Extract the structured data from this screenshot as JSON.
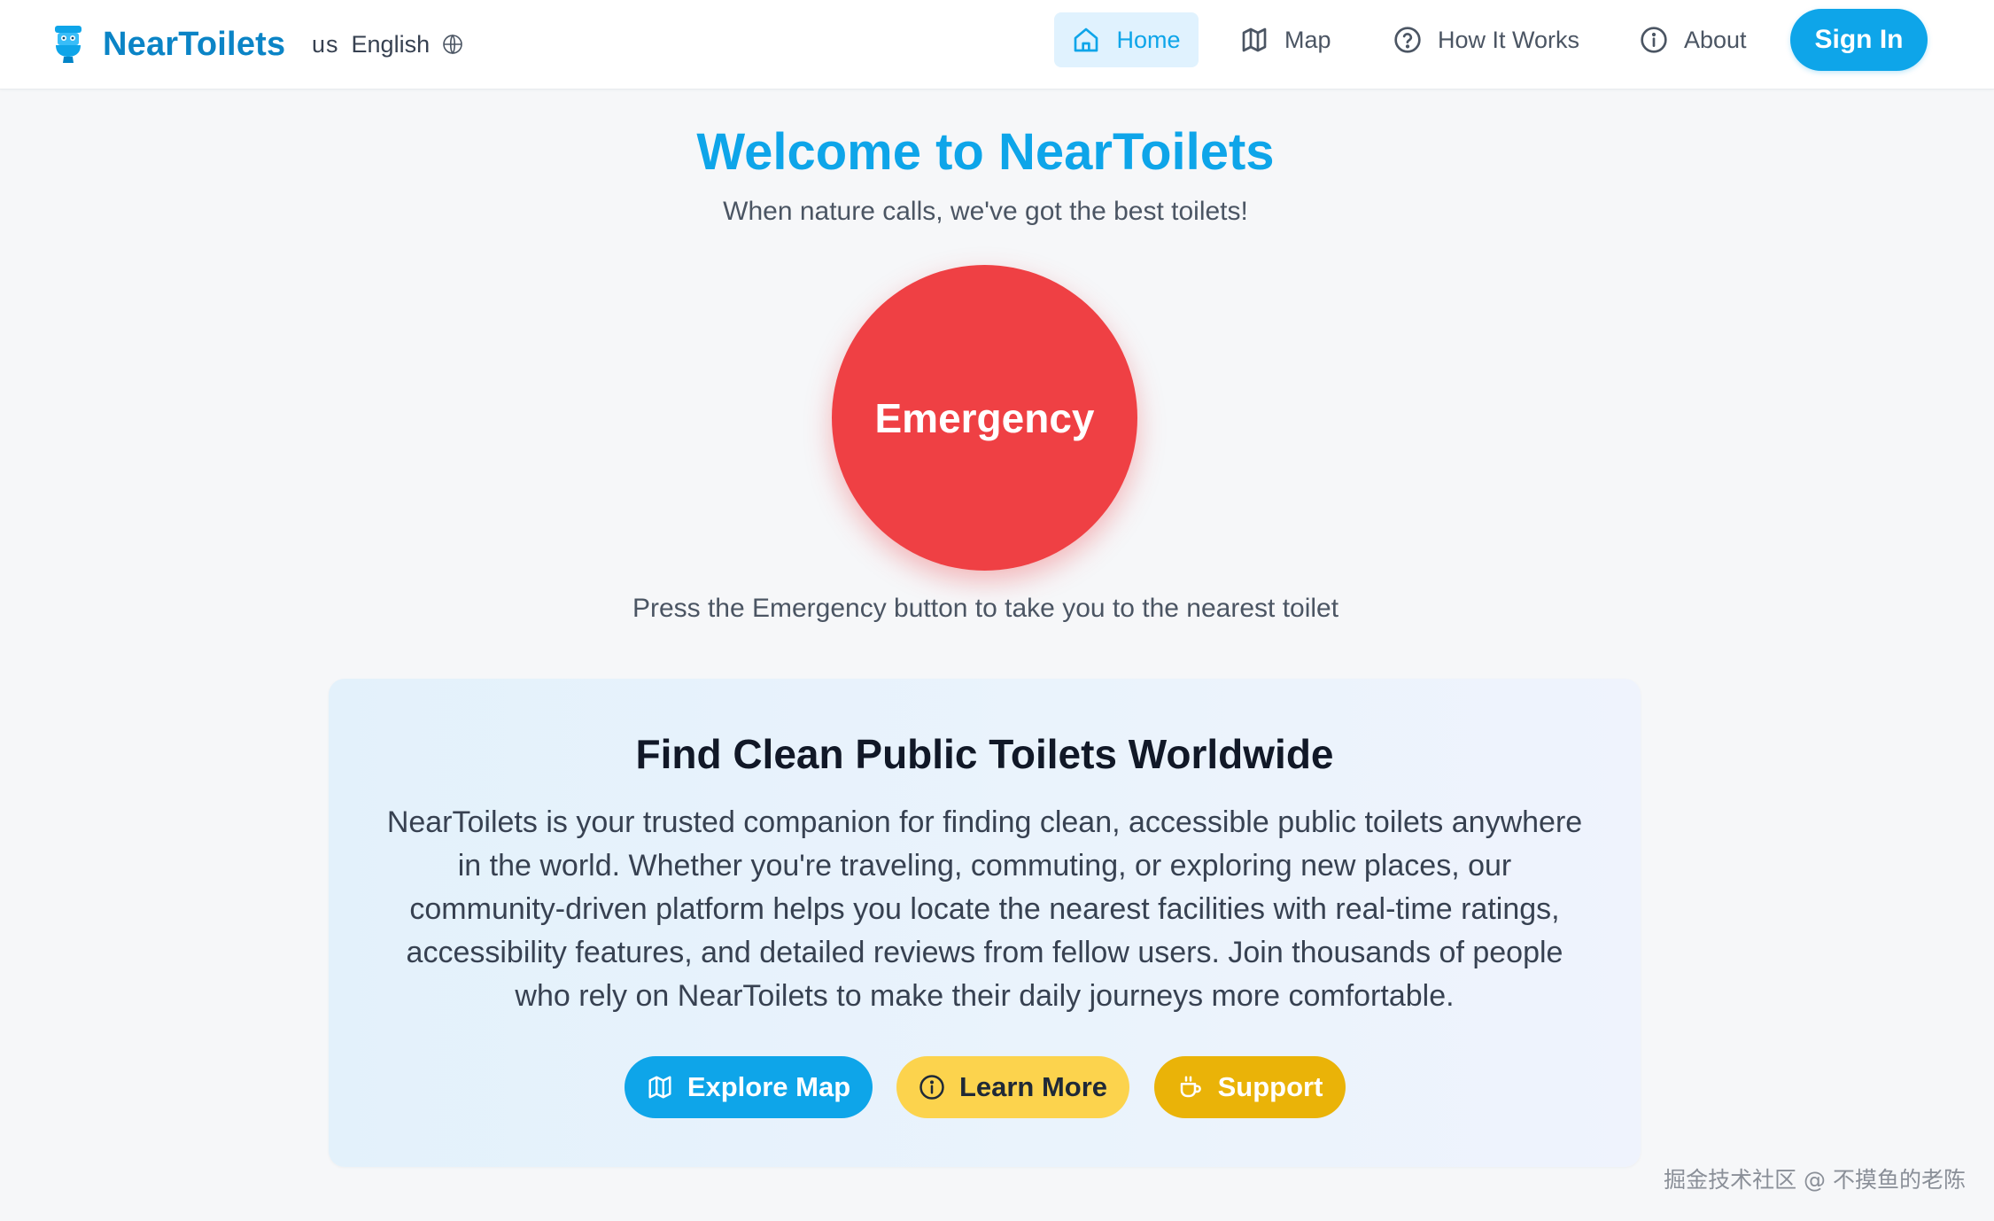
{
  "header": {
    "brand": "NearToilets",
    "language": {
      "flag": "us",
      "label": "English"
    },
    "nav": [
      {
        "label": "Home",
        "icon": "home-icon",
        "active": true
      },
      {
        "label": "Map",
        "icon": "map-icon",
        "active": false
      },
      {
        "label": "How It Works",
        "icon": "help-circle-icon",
        "active": false
      },
      {
        "label": "About",
        "icon": "info-icon",
        "active": false
      }
    ],
    "sign_in": "Sign In"
  },
  "hero": {
    "title": "Welcome to NearToilets",
    "subtitle": "When nature calls, we've got the best toilets!",
    "emergency_label": "Emergency",
    "emergency_hint": "Press the Emergency button to take you to the nearest toilet"
  },
  "feature": {
    "title": "Find Clean Public Toilets Worldwide",
    "body": "NearToilets is your trusted companion for finding clean, accessible public toilets anywhere in the world. Whether you're traveling, commuting, or exploring new places, our community-driven platform helps you locate the nearest facilities with real-time ratings, accessibility features, and detailed reviews from fellow users. Join thousands of people who rely on NearToilets to make their daily journeys more comfortable.",
    "buttons": [
      {
        "label": "Explore Map",
        "icon": "map-icon"
      },
      {
        "label": "Learn More",
        "icon": "info-icon"
      },
      {
        "label": "Support",
        "icon": "coffee-icon"
      }
    ]
  },
  "watermark": "掘金技术社区 @ 不摸鱼的老陈",
  "colors": {
    "primary": "#0ea5e9",
    "brand": "#0b84c6",
    "emergency": "#ef4044",
    "learn_more": "#fcd34d",
    "support": "#eab308",
    "background": "#f6f7f9"
  }
}
